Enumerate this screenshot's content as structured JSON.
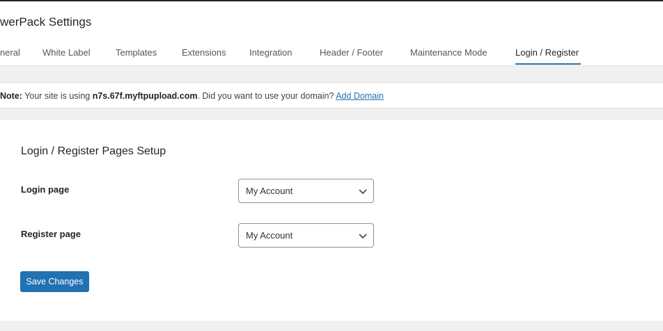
{
  "page": {
    "title": "werPack Settings"
  },
  "tabs": [
    {
      "label": "neral"
    },
    {
      "label": "White Label"
    },
    {
      "label": "Templates"
    },
    {
      "label": "Extensions"
    },
    {
      "label": "Integration"
    },
    {
      "label": "Header / Footer"
    },
    {
      "label": "Maintenance Mode"
    },
    {
      "label": "Login / Register"
    }
  ],
  "notice": {
    "prefix": "Note:",
    "text_before": " Your site is using ",
    "domain": "n7s.67f.myftpupload.com",
    "text_after": ". Did you want to use your domain? ",
    "link": "Add Domain"
  },
  "section": {
    "title": "Login / Register Pages Setup",
    "login_label": "Login page",
    "login_value": "My Account",
    "register_label": "Register page",
    "register_value": "My Account",
    "save_label": "Save Changes"
  },
  "colors": {
    "accent": "#2271b1"
  }
}
